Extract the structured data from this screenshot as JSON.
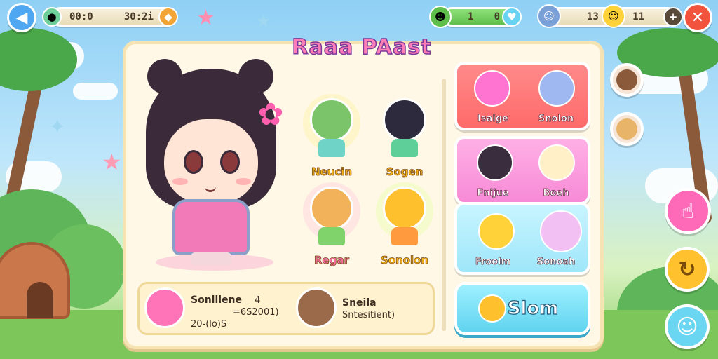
{
  "topbar": {
    "back_icon": "arrow-left",
    "timer_left": "00:0",
    "timer_right": "30:2i",
    "score_left": "1",
    "score_right": "0",
    "level_left": "13",
    "level_right": "11",
    "close_icon": "close-x"
  },
  "title": "Raaa PAast",
  "hero": {
    "icon": "bear-girl-character"
  },
  "characters": [
    {
      "name": "Neucin",
      "icon": "green-hair-character"
    },
    {
      "name": "Sogen",
      "icon": "black-cat-character"
    },
    {
      "name": "Regar",
      "icon": "fox-girl-character"
    },
    {
      "name": "Sonolon",
      "icon": "yellow-blob-character"
    }
  ],
  "info": {
    "left_name": "Soniliene",
    "left_stat": "4",
    "left_line2": "=6S2001)",
    "left_line3": "20-(lo)S",
    "right_name": "Sneila",
    "right_line2": "Sntesitient)"
  },
  "tiles": [
    {
      "left": "Isaige",
      "right": "Snolon"
    },
    {
      "left": "Fnijue",
      "right": "Boeh"
    },
    {
      "left": "Froolm",
      "right": "Sonoah"
    }
  ],
  "action_button": {
    "label": "Slom"
  },
  "colors": {
    "accent_pink": "#ff7eb8",
    "accent_blue": "#5fd3ef",
    "panel_bg": "#fff8e6",
    "close_red": "#f2533d"
  }
}
